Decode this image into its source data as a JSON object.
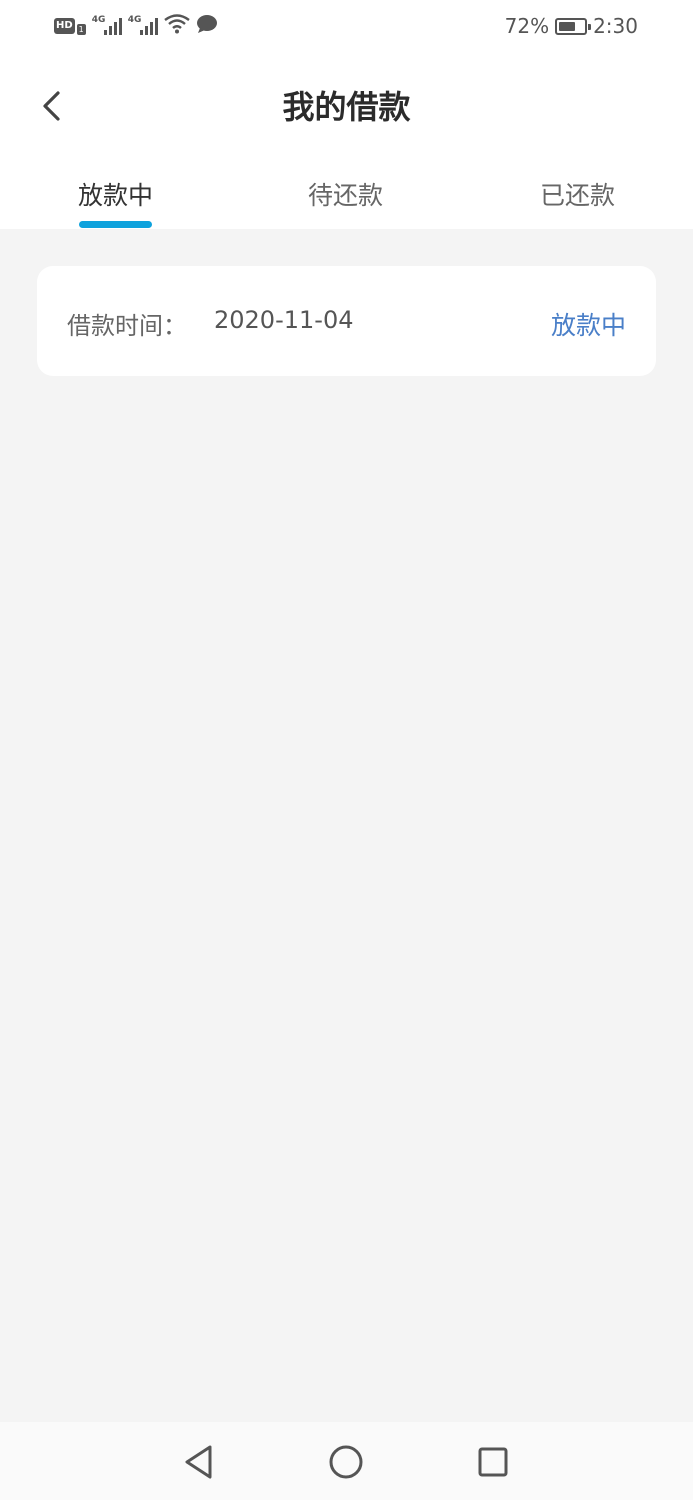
{
  "status_bar": {
    "hd_label": "HD",
    "hd_sub": "1",
    "sim1_tag": "4G",
    "sim2_tag": "4G",
    "battery_percent": "72%",
    "battery_level": 0.72,
    "time": "2:30",
    "icons": [
      "hd-icon",
      "signal-icon",
      "signal-icon",
      "wifi-icon",
      "message-icon",
      "battery-icon"
    ]
  },
  "header": {
    "title": "我的借款",
    "back_icon": "chevron-left-icon"
  },
  "tabs": [
    {
      "label": "放款中",
      "active": true
    },
    {
      "label": "待还款",
      "active": false
    },
    {
      "label": "已还款",
      "active": false
    }
  ],
  "colors": {
    "accent_indicator": "#0ea2dd",
    "status_text": "#4a7fc8",
    "page_background": "#f4f4f4"
  },
  "loans": [
    {
      "label": "借款时间：",
      "date": "2020-11-04",
      "status": "放款中"
    }
  ],
  "system_nav": {
    "icons": [
      "back-triangle-icon",
      "home-circle-icon",
      "recents-square-icon"
    ]
  }
}
